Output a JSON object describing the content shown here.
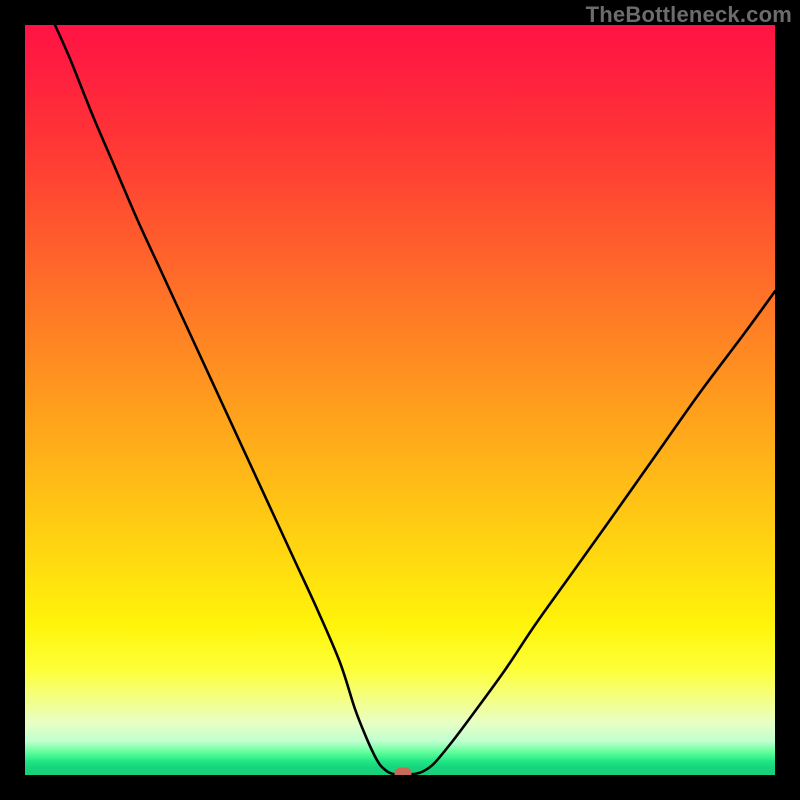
{
  "watermark": "TheBottleneck.com",
  "chart_data": {
    "type": "line",
    "title": "",
    "xlabel": "",
    "ylabel": "",
    "xlim": [
      0,
      100
    ],
    "ylim": [
      0,
      100
    ],
    "x": [
      4,
      6,
      9,
      12,
      15,
      18,
      21,
      24,
      27,
      30,
      33,
      36,
      39,
      42,
      44,
      45.5,
      46.5,
      47.3,
      48,
      48.5,
      49,
      49.3,
      49.6,
      50,
      51,
      52,
      53,
      54.5,
      57,
      60,
      64,
      68,
      73,
      78,
      84,
      90,
      96,
      100
    ],
    "y": [
      100,
      95.5,
      88,
      81,
      74,
      67.5,
      61,
      54.5,
      48,
      41.5,
      35,
      28.5,
      22,
      15,
      8.8,
      5,
      2.8,
      1.4,
      0.7,
      0.35,
      0.15,
      0.1,
      0.1,
      0.1,
      0.1,
      0.15,
      0.45,
      1.5,
      4.5,
      8.5,
      14,
      20,
      27,
      34,
      42.5,
      51,
      59,
      64.5
    ],
    "marker": {
      "x": 50.4,
      "y": 0.1,
      "color": "#c96a58"
    },
    "background_gradient": {
      "top": "#ff1344",
      "mid_upper": "#ff8423",
      "mid_lower": "#fff40a",
      "bottom": "#16d07a"
    }
  }
}
